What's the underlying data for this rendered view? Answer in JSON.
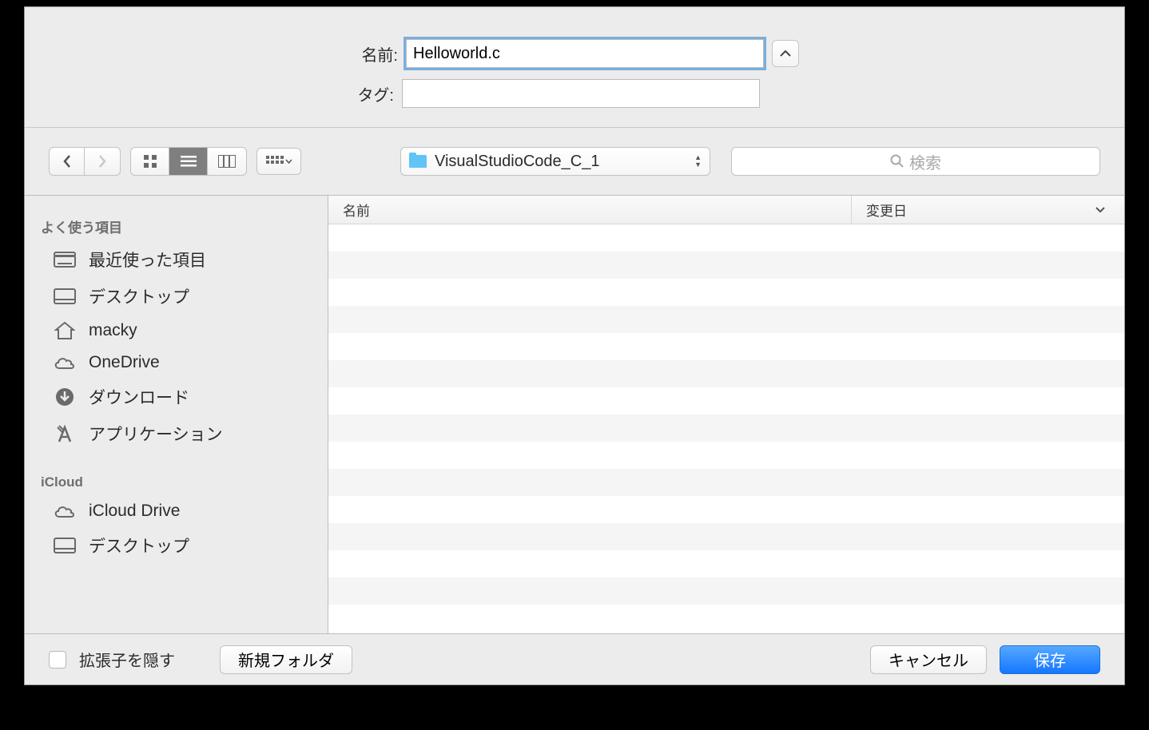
{
  "form": {
    "name_label": "名前:",
    "name_value": "Helloworld.c",
    "tags_label": "タグ:",
    "tags_value": ""
  },
  "toolbar": {
    "path_folder": "VisualStudioCode_C_1",
    "search_placeholder": "検索"
  },
  "sidebar": {
    "section1_header": "よく使う項目",
    "items1": [
      {
        "label": "最近使った項目"
      },
      {
        "label": "デスクトップ"
      },
      {
        "label": "macky"
      },
      {
        "label": "OneDrive"
      },
      {
        "label": "ダウンロード"
      },
      {
        "label": "アプリケーション"
      }
    ],
    "section2_header": "iCloud",
    "items2": [
      {
        "label": "iCloud Drive"
      },
      {
        "label": "デスクトップ"
      }
    ]
  },
  "columns": {
    "name": "名前",
    "date": "変更日"
  },
  "footer": {
    "hide_ext": "拡張子を隠す",
    "new_folder": "新規フォルダ",
    "cancel": "キャンセル",
    "save": "保存"
  }
}
